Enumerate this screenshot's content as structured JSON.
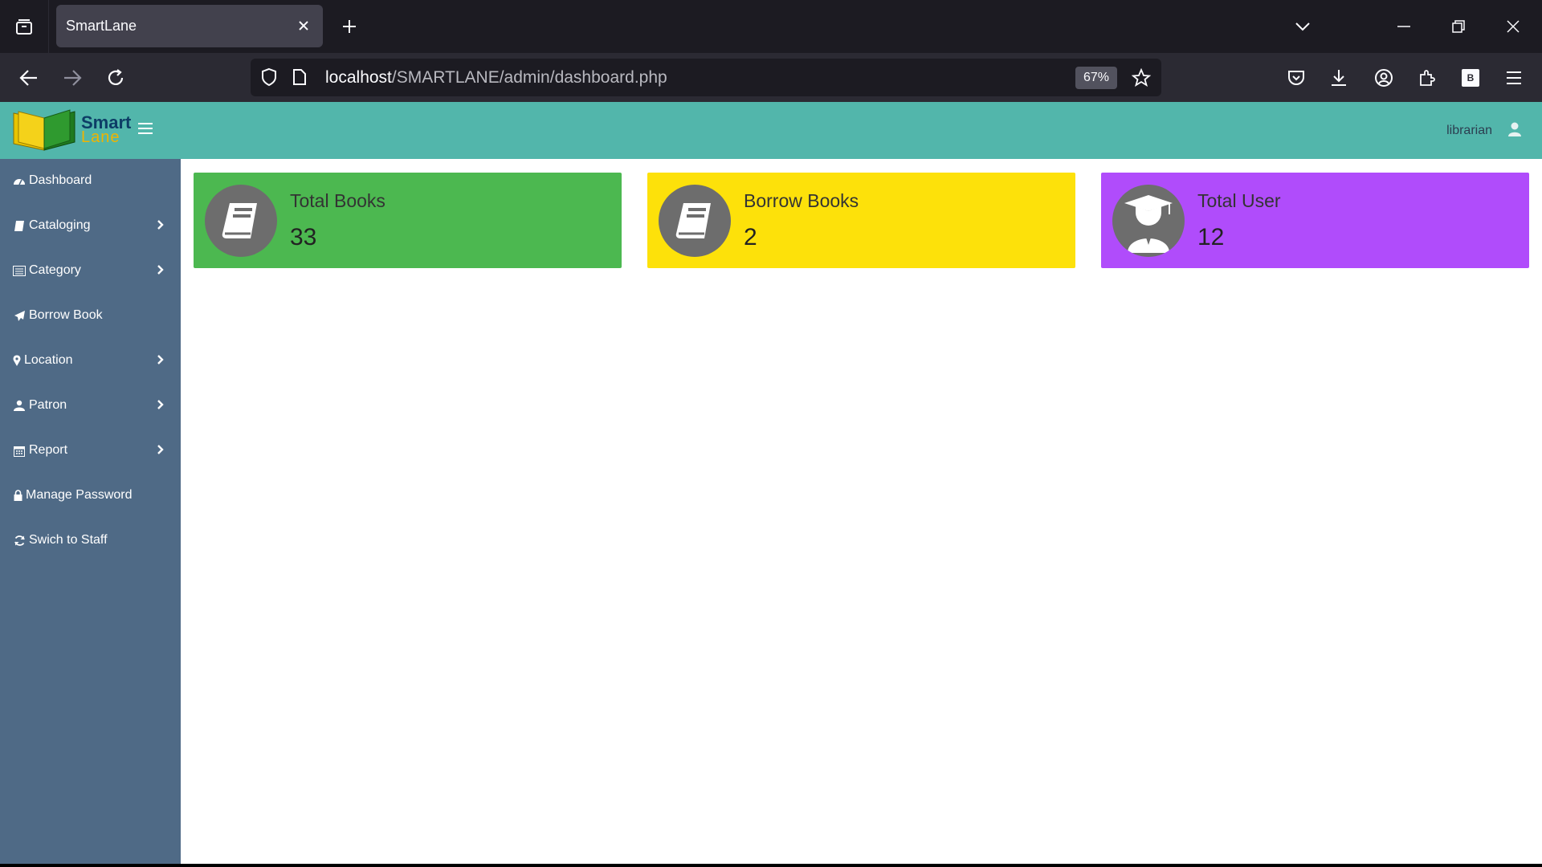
{
  "browser": {
    "tab_title": "SmartLane",
    "url_host": "localhost",
    "url_path": "/SMARTLANE/admin/dashboard.php",
    "zoom": "67%",
    "extension_letter": "B"
  },
  "app": {
    "logo_smart": "Smart",
    "logo_lane": "Lane",
    "user_name": "librarian",
    "colors": {
      "header": "#52b6ab",
      "sidebar": "#4f6a86",
      "card_books": "#4cb850",
      "card_borrow": "#fde10a",
      "card_users": "#b04cfb"
    }
  },
  "sidebar": {
    "items": [
      {
        "label": "Dashboard",
        "icon": "dashboard-icon",
        "has_submenu": false
      },
      {
        "label": "Cataloging",
        "icon": "book-icon",
        "has_submenu": true
      },
      {
        "label": "Category",
        "icon": "list-icon",
        "has_submenu": true
      },
      {
        "label": "Borrow Book",
        "icon": "send-icon",
        "has_submenu": false
      },
      {
        "label": "Location",
        "icon": "map-marker-icon",
        "has_submenu": true
      },
      {
        "label": "Patron",
        "icon": "users-icon",
        "has_submenu": true
      },
      {
        "label": "Report",
        "icon": "calendar-icon",
        "has_submenu": true
      },
      {
        "label": "Manage Password",
        "icon": "lock-icon",
        "has_submenu": false
      },
      {
        "label": "Swich to Staff",
        "icon": "refresh-icon",
        "has_submenu": false
      }
    ]
  },
  "cards": [
    {
      "title": "Total Books",
      "value": "33",
      "icon": "book-icon"
    },
    {
      "title": "Borrow Books",
      "value": "2",
      "icon": "book-icon"
    },
    {
      "title": "Total User",
      "value": "12",
      "icon": "graduate-user-icon"
    }
  ]
}
